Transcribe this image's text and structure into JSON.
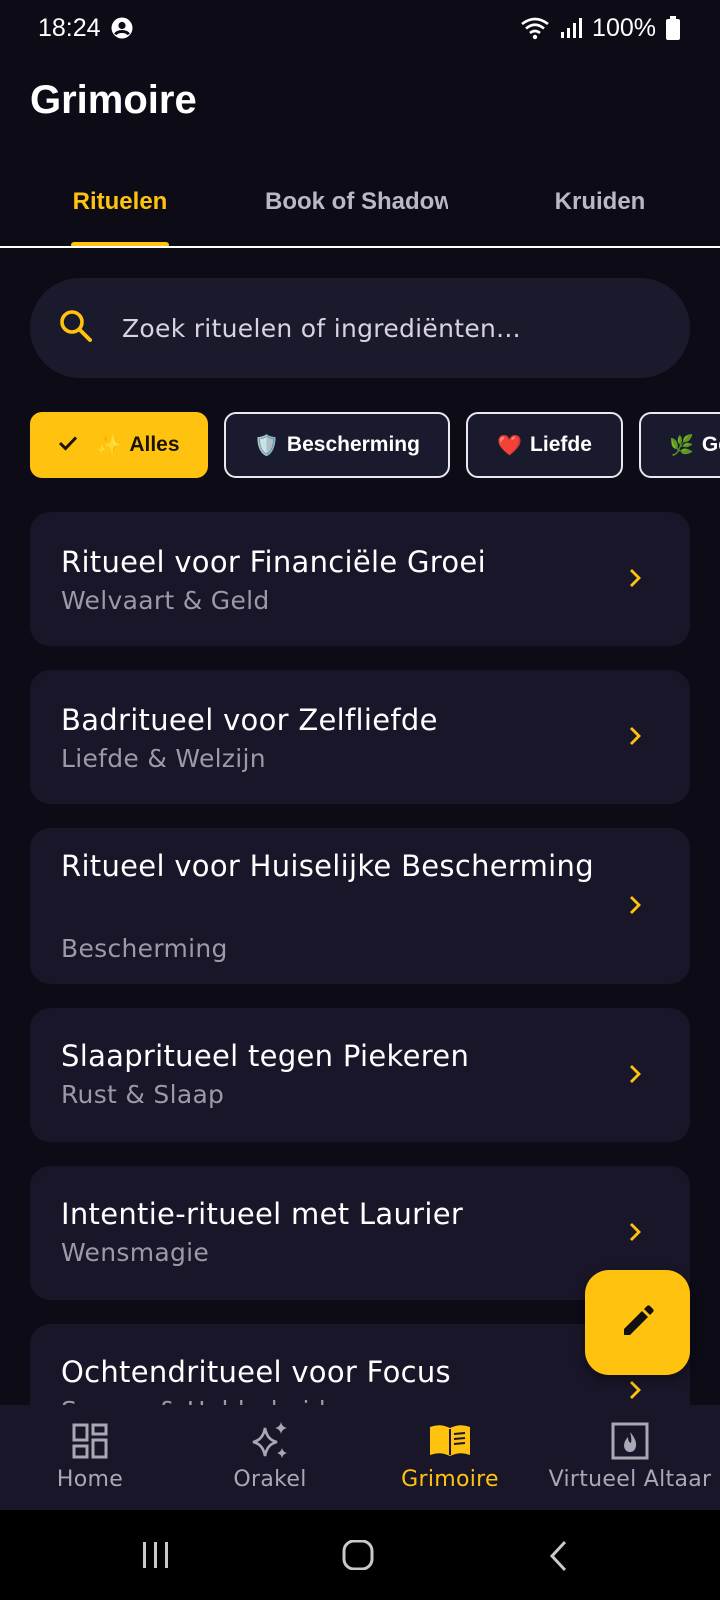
{
  "status_bar": {
    "time": "18:24",
    "battery": "100%",
    "icons": [
      "account-icon",
      "wifi-icon",
      "signal-icon",
      "battery-icon"
    ]
  },
  "header": {
    "title": "Grimoire"
  },
  "tabs": [
    {
      "label": "Rituelen",
      "active": true
    },
    {
      "label": "Book of Shadows",
      "active": false
    },
    {
      "label": "Kruiden",
      "active": false
    }
  ],
  "search": {
    "placeholder": "Zoek rituelen of ingrediënten...",
    "icon": "search-icon"
  },
  "filters": [
    {
      "emoji": "✨",
      "label": "Alles",
      "selected": true
    },
    {
      "emoji": "🛡️",
      "label": "Bescherming",
      "selected": false
    },
    {
      "emoji": "❤️",
      "label": "Liefde",
      "selected": false
    },
    {
      "emoji": "🌿",
      "label": "Gezondheid",
      "selected": false
    }
  ],
  "rituals": [
    {
      "title": "Ritueel voor Financiële Groei",
      "category": "Welvaart & Geld"
    },
    {
      "title": "Badritueel voor Zelfliefde",
      "category": "Liefde & Welzijn"
    },
    {
      "title": "Ritueel voor Huiselijke Bescherming",
      "category": "Bescherming"
    },
    {
      "title": "Slaapritueel tegen Piekeren",
      "category": "Rust & Slaap"
    },
    {
      "title": "Intentie-ritueel met Laurier",
      "category": "Wensmagie"
    },
    {
      "title": "Ochtendritueel voor Focus",
      "category": "Succes & Helderheid"
    }
  ],
  "fab": {
    "icon": "pencil-icon"
  },
  "bottom_nav": [
    {
      "label": "Home",
      "icon": "dashboard-icon",
      "active": false
    },
    {
      "label": "Orakel",
      "icon": "sparkles-icon",
      "active": false
    },
    {
      "label": "Grimoire",
      "icon": "book-icon",
      "active": true
    },
    {
      "label": "Virtueel Altaar",
      "icon": "fireplace-icon",
      "active": false
    }
  ],
  "colors": {
    "accent": "#ffc30f",
    "background": "#0c0b16",
    "card": "#181628",
    "muted_text": "#9b9aa6"
  }
}
